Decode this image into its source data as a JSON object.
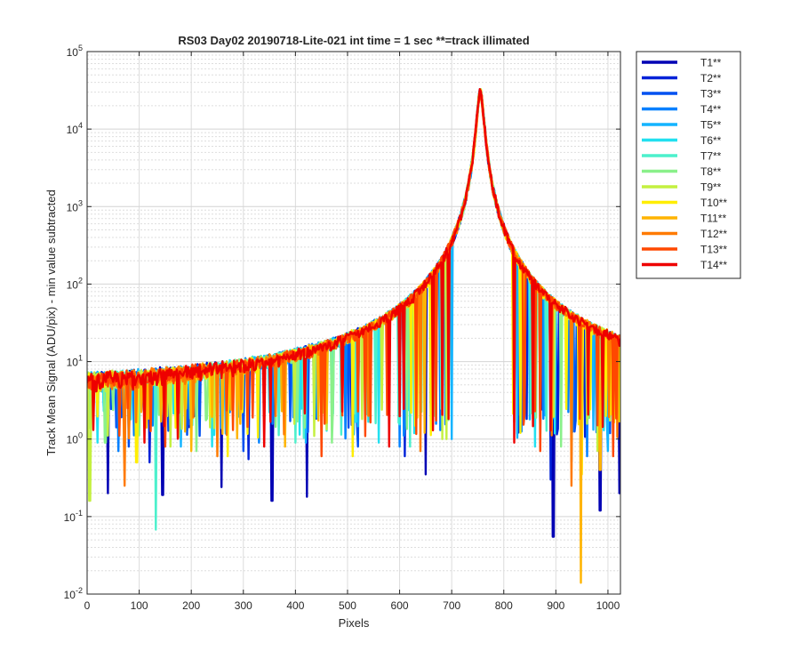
{
  "chart_data": {
    "type": "line",
    "title": "RS03 Day02 20190718-Lite-021 int time = 1 sec    **=track illimated",
    "xlabel": "Pixels",
    "ylabel": "Track Mean Signal (ADU/pix) - min value subtracted",
    "xlim": [
      0,
      1024
    ],
    "ylim": [
      0.01,
      100000
    ],
    "yscale": "log",
    "grid": true,
    "legend_position": "outside-right",
    "x_ticks": [
      0,
      100,
      200,
      300,
      400,
      500,
      600,
      700,
      800,
      900,
      1000
    ],
    "x_tick_labels": [
      "0",
      "100",
      "200",
      "300",
      "400",
      "500",
      "600",
      "700",
      "800",
      "900",
      "1000"
    ],
    "y_ticks": [
      {
        "base": "10",
        "exp": "-2"
      },
      {
        "base": "10",
        "exp": "-1"
      },
      {
        "base": "10",
        "exp": "0"
      },
      {
        "base": "10",
        "exp": "1"
      },
      {
        "base": "10",
        "exp": "2"
      },
      {
        "base": "10",
        "exp": "3"
      },
      {
        "base": "10",
        "exp": "4"
      },
      {
        "base": "10",
        "exp": "5"
      }
    ],
    "peak": {
      "x": 755,
      "y": 30000,
      "halfwidth_px": 6,
      "baseline": 4
    },
    "series": [
      {
        "name": "T1**",
        "color": "#0000b4",
        "dips": [
          [
            40,
            0.2
          ],
          [
            145,
            0.19
          ],
          [
            258,
            0.24
          ],
          [
            355,
            0.16
          ],
          [
            422,
            0.18
          ],
          [
            650,
            0.35
          ],
          [
            895,
            0.055
          ],
          [
            985,
            0.12
          ],
          [
            1022,
            0.2
          ]
        ]
      },
      {
        "name": "T2**",
        "color": "#0022d8",
        "dips": [
          [
            120,
            0.5
          ],
          [
            310,
            0.55
          ],
          [
            610,
            0.6
          ],
          [
            890,
            0.3
          ]
        ]
      },
      {
        "name": "T3**",
        "color": "#0050f0",
        "dips": [
          [
            80,
            0.8
          ],
          [
            300,
            0.7
          ],
          [
            520,
            0.8
          ],
          [
            930,
            0.5
          ]
        ]
      },
      {
        "name": "T4**",
        "color": "#0080ff",
        "dips": [
          [
            60,
            0.7
          ],
          [
            330,
            0.9
          ],
          [
            600,
            0.8
          ],
          [
            960,
            0.6
          ]
        ]
      },
      {
        "name": "T5**",
        "color": "#14b4ff",
        "dips": [
          [
            180,
            0.8
          ],
          [
            420,
            0.9
          ],
          [
            700,
            1.0
          ],
          [
            1000,
            0.7
          ]
        ]
      },
      {
        "name": "T6**",
        "color": "#22e0f0",
        "dips": [
          [
            20,
            0.9
          ],
          [
            240,
            0.8
          ],
          [
            560,
            0.9
          ],
          [
            860,
            0.8
          ]
        ]
      },
      {
        "name": "T7**",
        "color": "#4cf0cc",
        "dips": [
          [
            132,
            0.068
          ],
          [
            400,
            0.9
          ],
          [
            620,
            0.8
          ]
        ]
      },
      {
        "name": "T8**",
        "color": "#8af08a",
        "dips": [
          [
            35,
            0.9
          ],
          [
            210,
            0.7
          ],
          [
            470,
            0.9
          ],
          [
            910,
            0.8
          ]
        ]
      },
      {
        "name": "T9**",
        "color": "#c4f040",
        "dips": [
          [
            5,
            0.16
          ],
          [
            160,
            0.8
          ],
          [
            690,
            1.0
          ],
          [
            980,
            0.7
          ]
        ]
      },
      {
        "name": "T10**",
        "color": "#ffee00",
        "dips": [
          [
            95,
            0.5
          ],
          [
            270,
            0.6
          ],
          [
            510,
            0.6
          ],
          [
            950,
            0.35
          ]
        ]
      },
      {
        "name": "T11**",
        "color": "#ffb400",
        "dips": [
          [
            200,
            0.7
          ],
          [
            380,
            0.8
          ],
          [
            948,
            0.014
          ],
          [
            985,
            0.4
          ]
        ]
      },
      {
        "name": "T12**",
        "color": "#ff7a00",
        "dips": [
          [
            72,
            0.25
          ],
          [
            250,
            0.6
          ],
          [
            640,
            0.7
          ],
          [
            930,
            0.25
          ]
        ]
      },
      {
        "name": "T13**",
        "color": "#ff4800",
        "dips": [
          [
            150,
            0.8
          ],
          [
            450,
            0.6
          ],
          [
            870,
            0.7
          ],
          [
            1010,
            0.6
          ]
        ]
      },
      {
        "name": "T14**",
        "color": "#ee0000",
        "dips": [
          [
            110,
            0.9
          ],
          [
            340,
            0.8
          ],
          [
            580,
            0.8
          ],
          [
            820,
            0.9
          ]
        ]
      }
    ]
  }
}
